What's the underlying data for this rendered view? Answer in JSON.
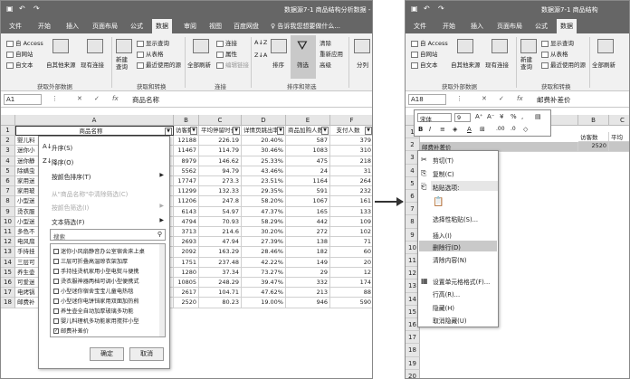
{
  "left": {
    "title": "数据源7-1 商品结构分析数据 -",
    "tabs": [
      "文件",
      "开始",
      "插入",
      "页面布局",
      "公式",
      "数据",
      "审阅",
      "视图",
      "百度网盘",
      "♀ 告诉我您想要做什么..."
    ],
    "ribbon": {
      "from_access": "自 Access",
      "from_web": "自网站",
      "from_text": "自文本",
      "from_other": "自其他来源",
      "existing": "现有连接",
      "new_query": "新建\n查询",
      "show_query": "显示查询",
      "from_table": "从表格",
      "recent": "最近使用的源",
      "refresh_all": "全部刷新",
      "connections": "连接",
      "properties": "属性",
      "edit_links": "编辑链接",
      "sort_az": "A↓Z",
      "sort_za": "Z↓A",
      "sort": "排序",
      "filter": "筛选",
      "clear": "清除",
      "reapply": "重新应用",
      "advanced": "高级",
      "split": "分列",
      "grp_external": "获取外部数据",
      "grp_transform": "获取和转换",
      "grp_connect": "连接",
      "grp_sort": "排序和筛选"
    },
    "namebox": "A1",
    "formula": "商品名称",
    "columns": [
      "A",
      "B",
      "C",
      "D",
      "E",
      "F"
    ],
    "headers": [
      "商品名称",
      "访客数",
      "平均停留时长",
      "详情页跳出率",
      "商品加购人数",
      "支付人数"
    ],
    "rows": [
      [
        "婴儿料",
        "12188",
        "226.19",
        "20.40%",
        "587",
        "379"
      ],
      [
        "迷你小",
        "11467",
        "114.79",
        "30.46%",
        "1083",
        "310"
      ],
      [
        "迷你静",
        "8979",
        "146.62",
        "25.33%",
        "475",
        "218"
      ],
      [
        "除螨虫",
        "5562",
        "94.79",
        "43.46%",
        "24",
        "31"
      ],
      [
        "家用迷",
        "17747",
        "273.3",
        "23.51%",
        "1164",
        "264"
      ],
      [
        "家用玻",
        "11299",
        "132.33",
        "29.35%",
        "591",
        "232"
      ],
      [
        "小型迷",
        "11206",
        "247.8",
        "58.20%",
        "1067",
        "161"
      ],
      [
        "烫衣服",
        "6143",
        "54.97",
        "47.37%",
        "165",
        "133"
      ],
      [
        "小型迷",
        "4794",
        "70.93",
        "58.29%",
        "442",
        "109"
      ],
      [
        "多色不",
        "3713",
        "214.6",
        "30.20%",
        "272",
        "102"
      ],
      [
        "电风扇",
        "2693",
        "47.94",
        "27.39%",
        "138",
        "71"
      ],
      [
        "手持挂",
        "2092",
        "163.29",
        "28.46%",
        "182",
        "60"
      ],
      [
        "三层可",
        "1751",
        "237.48",
        "42.22%",
        "149",
        "20"
      ],
      [
        "养生壶",
        "1280",
        "37.34",
        "73.27%",
        "29",
        "12"
      ],
      [
        "可爱迷",
        "10805",
        "248.29",
        "39.47%",
        "332",
        "174"
      ],
      [
        "电烤锅",
        "2617",
        "104.71",
        "47.62%",
        "213",
        "88"
      ],
      [
        "邮费补",
        "2520",
        "80.23",
        "19.00%",
        "946",
        "590"
      ]
    ],
    "filter_menu": {
      "sort_asc": "升序(S)",
      "sort_desc": "降序(O)",
      "sort_color": "按颜色排序(T)",
      "clear": "从\"商品名称\"中清除筛选(C)",
      "filter_color": "按颜色筛选(I)",
      "text_filter": "文本筛选(F)",
      "search_placeholder": "搜索",
      "items": [
        "迷你小风扇静音办公室宿舍床上桌",
        "三层可折叠高温晾衣架加厚",
        "手持挂烫机家用小型电熨斗便携",
        "烫衣服神器两档可调小型便携式",
        "小型迷你宿舍宝宝儿童电热毯",
        "小型迷你电饼铛家用双面加热煎",
        "养生壶全自动加厚玻璃多功能",
        "婴儿料理机多功能家用搅拌小型",
        "邮费补差价"
      ],
      "ok": "确定",
      "cancel": "取消"
    }
  },
  "right": {
    "title": "数据源7-1 商品结构",
    "tabs": [
      "文件",
      "开始",
      "插入",
      "页面布局",
      "公式",
      "数据"
    ],
    "ribbon": {
      "from_access": "自 Access",
      "from_web": "自网站",
      "from_text": "自文本",
      "from_other": "自其他来源",
      "existing": "现有连接",
      "new_query": "新建\n查询",
      "show_query": "显示查询",
      "from_table": "从表格",
      "recent": "最近使用的源",
      "refresh_all": "全部刷新",
      "grp_external": "获取外部数据",
      "grp_transform": "获取和转换"
    },
    "namebox": "A18",
    "formula": "邮费补差价",
    "col_b": "B",
    "col_c": "C",
    "head_b": "访客数",
    "head_c": "平均",
    "row_value": "2520",
    "row_label": "邮费补差价",
    "mini": {
      "font": "宋体",
      "size": "9"
    },
    "context_menu": [
      "剪切(T)",
      "复制(C)",
      "粘贴选项:",
      "选择性粘贴(S)...",
      "插入(I)",
      "删除行(D)",
      "清除内容(N)",
      "设置单元格格式(F)...",
      "行高(R)...",
      "隐藏(H)",
      "取消隐藏(U)"
    ],
    "rows": [
      "1",
      "2",
      "3",
      "4",
      "5",
      "6",
      "7",
      "8",
      "9",
      "10",
      "11",
      "12",
      "13",
      "14",
      "15",
      "16",
      "17",
      "18",
      "19",
      "20"
    ]
  }
}
